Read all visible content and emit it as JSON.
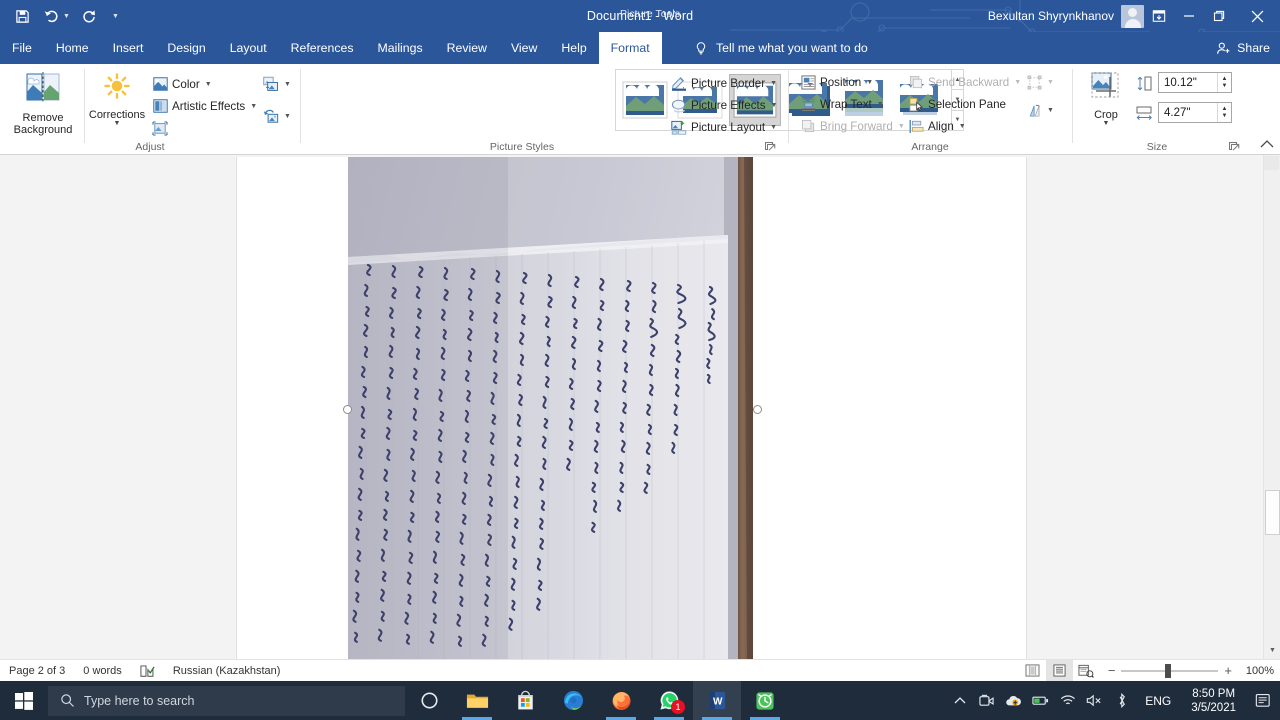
{
  "titlebar": {
    "quick_access": [
      {
        "name": "save-icon",
        "label": "Save"
      },
      {
        "name": "undo-icon",
        "label": "Undo"
      },
      {
        "name": "redo-icon",
        "label": "Redo"
      },
      {
        "name": "customize-quick-access-icon",
        "label": "Customize Quick Access Toolbar"
      }
    ],
    "document_title": "Document1  -  Word",
    "contextual_tab": "Picture Tools",
    "account_name": "Bexultan Shyrynkhanov",
    "ribbon_display_options": "Ribbon Display Options",
    "minimize": "Minimize",
    "restore": "Restore Down",
    "close": "Close",
    "accent_color": "#2b579a"
  },
  "tabs": [
    {
      "label": "File",
      "active": false
    },
    {
      "label": "Home",
      "active": false
    },
    {
      "label": "Insert",
      "active": false
    },
    {
      "label": "Design",
      "active": false
    },
    {
      "label": "Layout",
      "active": false
    },
    {
      "label": "References",
      "active": false
    },
    {
      "label": "Mailings",
      "active": false
    },
    {
      "label": "Review",
      "active": false
    },
    {
      "label": "View",
      "active": false
    },
    {
      "label": "Help",
      "active": false
    },
    {
      "label": "Format",
      "active": true
    }
  ],
  "tellme": {
    "placeholder": "Tell me what you want to do"
  },
  "share": {
    "label": "Share"
  },
  "ribbon": {
    "groups": [
      {
        "name": "adjust",
        "label": "Adjust",
        "buttons": [
          {
            "label": "Remove\nBackground",
            "line1": "Remove",
            "line2": "Background",
            "icon": "remove-background-icon"
          },
          {
            "label": "Corrections",
            "icon": "corrections-icon",
            "has_dropdown": true
          },
          {
            "label": "Color",
            "icon": "color-icon",
            "has_dropdown": true
          },
          {
            "label": "Artistic Effects",
            "icon": "artistic-effects-icon",
            "has_dropdown": true
          },
          {
            "label": "Transparency",
            "icon": "transparency-icon",
            "has_dropdown": false
          },
          {
            "label": "Compress Pictures",
            "icon": "compress-pictures-icon",
            "has_dropdown": true
          },
          {
            "label": "Reset Picture",
            "icon": "reset-picture-icon",
            "has_dropdown": true
          }
        ]
      },
      {
        "name": "picture-styles",
        "label": "Picture Styles",
        "gallery_selected_index": 2,
        "gallery_count": 6,
        "buttons": [
          {
            "label": "Picture Border",
            "icon": "picture-border-icon",
            "has_dropdown": true
          },
          {
            "label": "Picture Effects",
            "icon": "picture-effects-icon",
            "has_dropdown": true
          },
          {
            "label": "Picture Layout",
            "icon": "picture-layout-icon",
            "has_dropdown": true
          }
        ]
      },
      {
        "name": "arrange",
        "label": "Arrange",
        "buttons": [
          {
            "label": "Position",
            "icon": "position-icon",
            "has_dropdown": true,
            "disabled": false
          },
          {
            "label": "Wrap Text",
            "icon": "wrap-text-icon",
            "has_dropdown": true,
            "disabled": false
          },
          {
            "label": "Bring Forward",
            "icon": "bring-forward-icon",
            "has_dropdown": true,
            "disabled": true
          },
          {
            "label": "Send Backward",
            "icon": "send-backward-icon",
            "has_dropdown": true,
            "disabled": true
          },
          {
            "label": "Selection Pane",
            "icon": "selection-pane-icon",
            "has_dropdown": false,
            "disabled": false
          },
          {
            "label": "Align",
            "icon": "align-icon",
            "has_dropdown": true,
            "disabled": false
          },
          {
            "label": "Group",
            "icon": "group-icon",
            "has_dropdown": true,
            "disabled": true
          },
          {
            "label": "Rotate",
            "icon": "rotate-icon",
            "has_dropdown": true,
            "disabled": false
          }
        ]
      },
      {
        "name": "size",
        "label": "Size",
        "crop_label": "Crop",
        "crop_icon": "crop-icon",
        "shape_height": "10.12\"",
        "shape_width": "4.27\"",
        "height_icon": "shape-height-icon",
        "width_icon": "shape-width-icon"
      }
    ],
    "collapse_icon": "collapse-ribbon-icon"
  },
  "document": {
    "picture": {
      "name": "inserted-photograph",
      "description": "Photograph of a handwritten notebook page rotated 90 degrees",
      "selected": true,
      "handles": [
        "left-middle-handle",
        "right-middle-handle"
      ]
    }
  },
  "statusbar": {
    "page": "Page 2 of 3",
    "words": "0 words",
    "proofing_icon": "proofing-errors-icon",
    "language": "Russian (Kazakhstan)",
    "views": [
      {
        "name": "read-mode-view",
        "icon": "read-mode-icon",
        "active": false
      },
      {
        "name": "print-layout-view",
        "icon": "print-layout-icon",
        "active": true
      },
      {
        "name": "web-layout-view",
        "icon": "web-layout-icon",
        "active": false
      }
    ],
    "zoom_out": "−",
    "zoom_in": "+",
    "zoom_level": "100%"
  },
  "taskbar": {
    "start": "Start",
    "search_placeholder": "Type here to search",
    "search_icon": "search-icon",
    "items": [
      {
        "name": "cortana-icon",
        "label": "Cortana",
        "running": false
      },
      {
        "name": "file-explorer-icon",
        "label": "File Explorer",
        "running": true
      },
      {
        "name": "microsoft-store-icon",
        "label": "Microsoft Store",
        "running": false
      },
      {
        "name": "microsoft-edge-icon",
        "label": "Microsoft Edge",
        "running": false
      },
      {
        "name": "firefox-icon",
        "label": "Mozilla Firefox",
        "running": true
      },
      {
        "name": "whatsapp-icon",
        "label": "WhatsApp",
        "running": true,
        "badge": "1"
      },
      {
        "name": "word-icon",
        "label": "Word",
        "running": true,
        "active": true
      },
      {
        "name": "alarm-clock-icon",
        "label": "Alarms & Clock",
        "running": true
      }
    ],
    "tray": [
      {
        "name": "show-hidden-icons-chevron",
        "label": "Show hidden icons"
      },
      {
        "name": "camera-icon",
        "label": "Camera"
      },
      {
        "name": "onedrive-icon",
        "label": "OneDrive"
      },
      {
        "name": "battery-icon",
        "label": "Battery"
      },
      {
        "name": "network-icon",
        "label": "Network"
      },
      {
        "name": "volume-muted-icon",
        "label": "Volume muted"
      },
      {
        "name": "bluetooth-icon",
        "label": "Bluetooth"
      }
    ],
    "language": "ENG",
    "time": "8:50 PM",
    "date": "3/5/2021",
    "notifications_icon": "action-center-icon"
  }
}
